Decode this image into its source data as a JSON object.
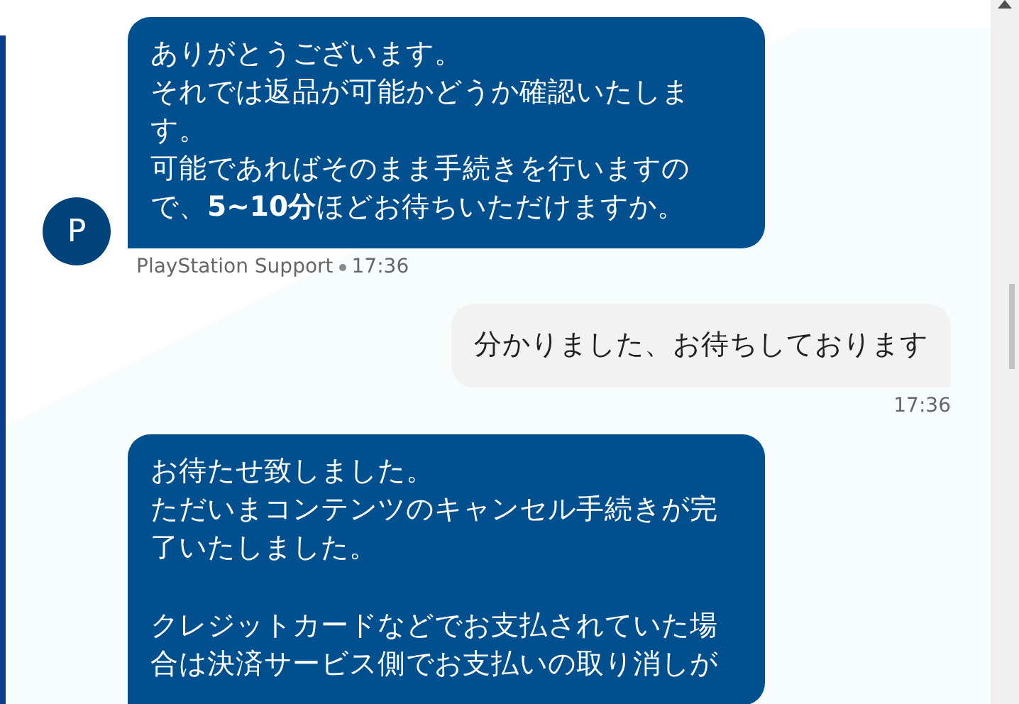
{
  "messages": [
    {
      "kind": "agent",
      "avatar": "P",
      "paragraphs": [
        [
          "ありがとうございます。",
          "それでは返品が可能かどうか確認いたします。",
          "可能であればそのまま手続きを行いますので、**5~10分**ほどお待ちいただけますか。"
        ]
      ],
      "sender": "PlayStation Support",
      "time": "17:36"
    },
    {
      "kind": "user",
      "paragraphs": [
        [
          "分かりました、お待ちしております"
        ]
      ],
      "time": "17:36"
    },
    {
      "kind": "agent",
      "paragraphs": [
        [
          "お待たせ致しました。",
          "ただいまコンテンツのキャンセル手続きが完了いたしました。"
        ],
        [
          "クレジットカードなどでお支払されていた場合は決済サービス側でお支払いの取り消しが"
        ]
      ]
    }
  ]
}
